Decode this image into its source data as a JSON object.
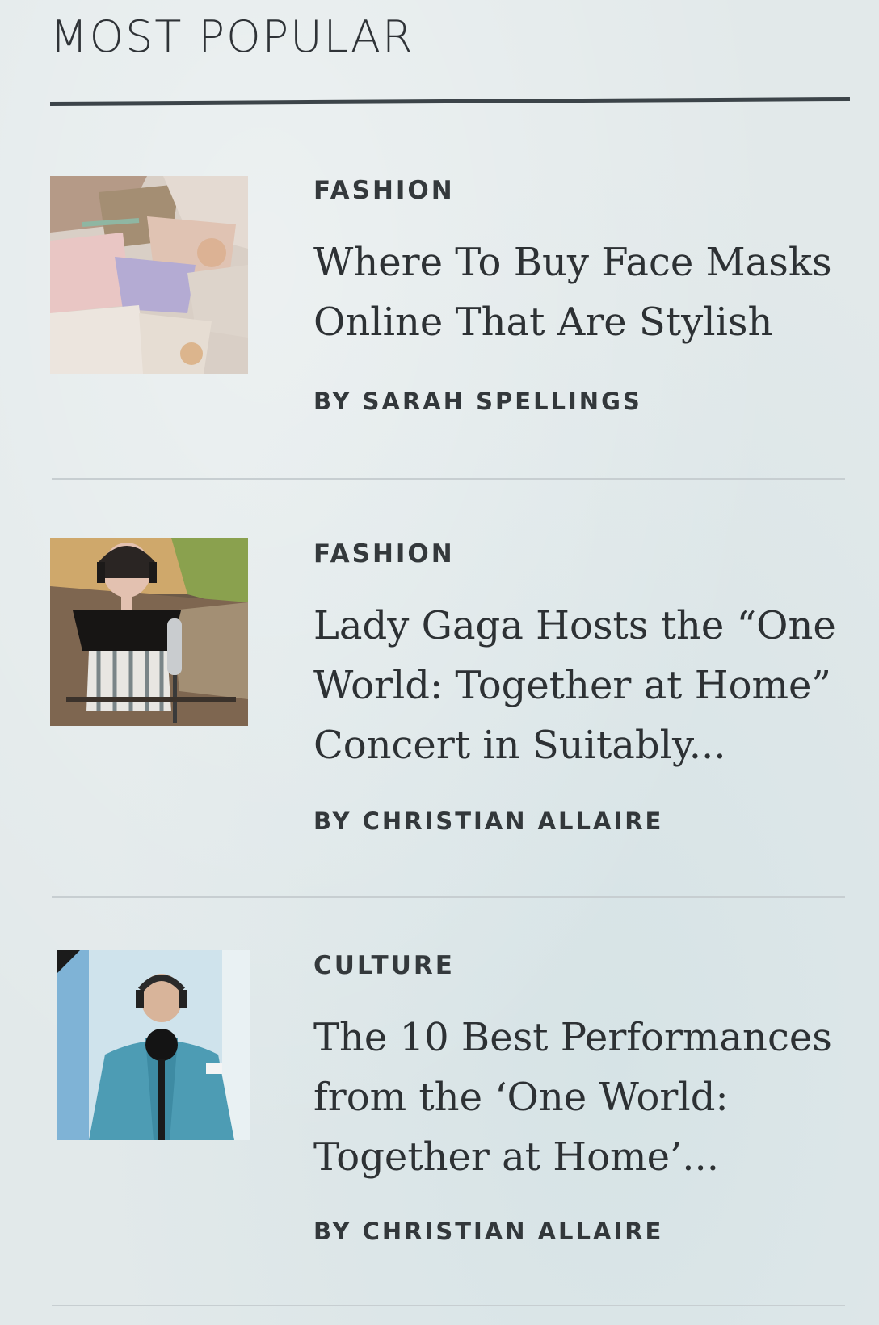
{
  "section": {
    "title": "MOST POPULAR"
  },
  "articles": [
    {
      "category": "FASHION",
      "headline": "Where To Buy Face Masks Online That Are Stylish",
      "byline_prefix": "BY",
      "author": "SARAH SPELLINGS",
      "thumbnail": "face-masks-photo"
    },
    {
      "category": "FASHION",
      "headline": "Lady Gaga Hosts the “One World: Together at Home” Concert in Suitably...",
      "byline_prefix": "BY",
      "author": "CHRISTIAN ALLAIRE",
      "thumbnail": "singer-with-headphones-photo"
    },
    {
      "category": "CULTURE",
      "headline": "The 10 Best Performances from the ‘One World: Together at Home’...",
      "byline_prefix": "BY",
      "author": "CHRISTIAN ALLAIRE",
      "thumbnail": "performer-at-microphone-photo"
    }
  ],
  "colors": {
    "background": "#e2e9ea",
    "text": "#2f3336",
    "rule": "#3c4449",
    "divider": "#c7ced1"
  }
}
